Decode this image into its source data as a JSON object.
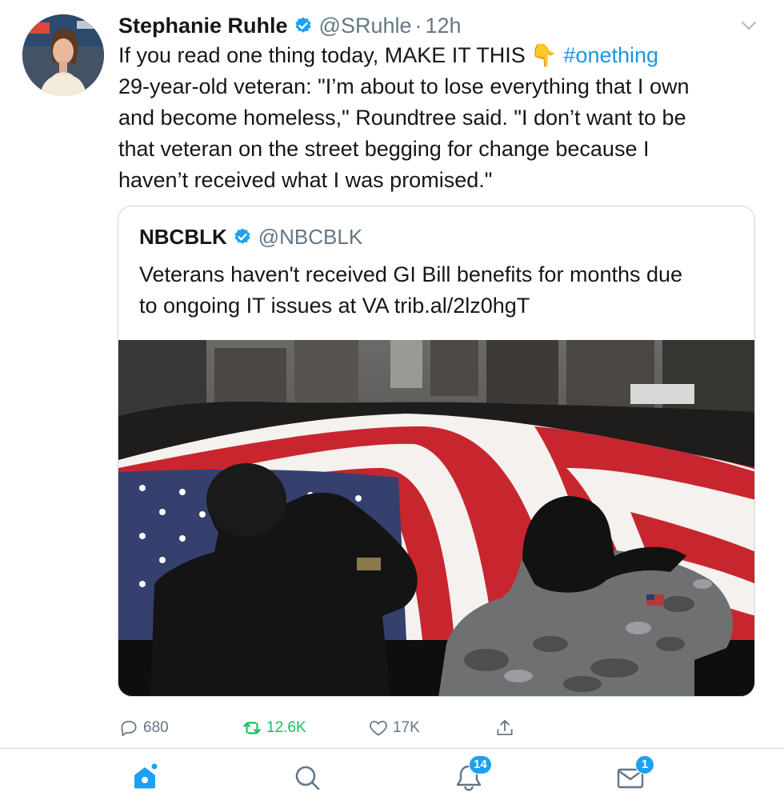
{
  "tweet": {
    "author": {
      "display_name": "Stephanie Ruhle",
      "handle": "@SRuhle",
      "verified": true
    },
    "separator": "·",
    "time": "12h",
    "text_lines": [
      "If you read one thing today, MAKE IT THIS",
      "29-year-old veteran: \"I’m about to lose everything that I own",
      "and become homeless,\" Roundtree said. \"I don’t want to be",
      "that veteran on the street begging for change because I",
      "haven’t received what I was promised.\""
    ],
    "emoji": "👇",
    "hashtag": "#onething",
    "quoted": {
      "display_name": "NBCBLK",
      "handle": "@NBCBLK",
      "verified": true,
      "text_lines": [
        "Veterans haven't received GI Bill benefits for months due",
        "to ongoing IT issues at VA trib.al/2lz0hgT"
      ],
      "image": "Two soldiers saluting in front of a large American flag carried down a city street"
    },
    "actions": {
      "replies": "680",
      "retweets": "12.6K",
      "likes": "17K"
    }
  },
  "tabbar": {
    "notifications_badge": "14",
    "messages_badge": "1"
  },
  "colors": {
    "accent": "#1DA1F2",
    "hashtag": "#1B95E0",
    "retweeted": "#17BF63",
    "secondary_text": "#657786",
    "border": "#CCD6DD"
  },
  "icons": [
    "verified-badge-icon",
    "chevron-down-icon",
    "reply-icon",
    "retweet-icon",
    "heart-icon",
    "share-icon",
    "home-icon",
    "search-icon",
    "bell-icon",
    "mail-icon"
  ]
}
